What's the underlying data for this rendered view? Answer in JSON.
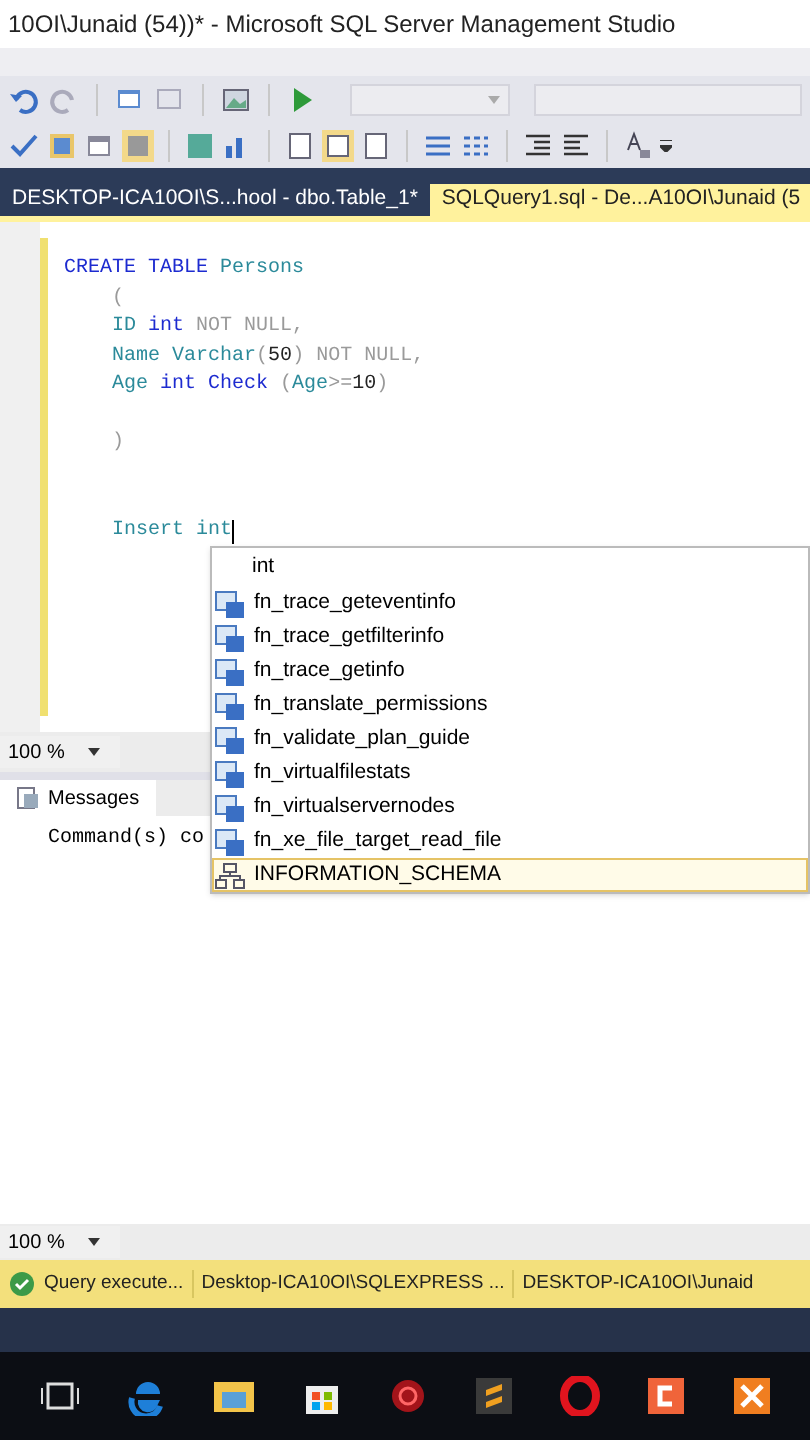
{
  "window": {
    "title": "10OI\\Junaid (54))* - Microsoft SQL Server Management Studio"
  },
  "tabs": [
    {
      "label": "DESKTOP-ICA10OI\\S...hool - dbo.Table_1*",
      "selected": false
    },
    {
      "label": "SQLQuery1.sql - De...A10OI\\Junaid (5",
      "selected": true
    }
  ],
  "editor": {
    "lines": [
      [
        {
          "text": "CREATE TABLE ",
          "kind": "keyword"
        },
        {
          "text": "Persons",
          "kind": "ident"
        }
      ],
      [
        {
          "text": "    (",
          "kind": "gray"
        }
      ],
      [
        {
          "text": "    ID ",
          "kind": "ident"
        },
        {
          "text": "int ",
          "kind": "keyword"
        },
        {
          "text": "NOT NULL,",
          "kind": "gray"
        }
      ],
      [
        {
          "text": "    Name ",
          "kind": "ident"
        },
        {
          "text": "Varchar",
          "kind": "ident"
        },
        {
          "text": "(",
          "kind": "gray"
        },
        {
          "text": "50",
          "kind": "plain"
        },
        {
          "text": ") NOT NULL,",
          "kind": "gray"
        }
      ],
      [
        {
          "text": "    Age ",
          "kind": "ident"
        },
        {
          "text": "int Check ",
          "kind": "keyword"
        },
        {
          "text": "(",
          "kind": "gray"
        },
        {
          "text": "Age",
          "kind": "ident"
        },
        {
          "text": ">=",
          "kind": "gray"
        },
        {
          "text": "10",
          "kind": "plain"
        },
        {
          "text": ")",
          "kind": "gray"
        }
      ],
      [
        {
          "kind": "blank"
        }
      ],
      [
        {
          "text": "    )",
          "kind": "gray"
        }
      ],
      [
        {
          "kind": "blank"
        }
      ],
      [
        {
          "kind": "blank"
        }
      ],
      [
        {
          "text": "    Insert int",
          "kind": "ident"
        }
      ]
    ]
  },
  "autocomplete": {
    "filter": "int",
    "items": [
      {
        "label": "fn_trace_geteventinfo",
        "kind": "function",
        "selected": false
      },
      {
        "label": "fn_trace_getfilterinfo",
        "kind": "function",
        "selected": false
      },
      {
        "label": "fn_trace_getinfo",
        "kind": "function",
        "selected": false
      },
      {
        "label": "fn_translate_permissions",
        "kind": "function",
        "selected": false
      },
      {
        "label": "fn_validate_plan_guide",
        "kind": "function",
        "selected": false
      },
      {
        "label": "fn_virtualfilestats",
        "kind": "function",
        "selected": false
      },
      {
        "label": "fn_virtualservernodes",
        "kind": "function",
        "selected": false
      },
      {
        "label": "fn_xe_file_target_read_file",
        "kind": "function",
        "selected": false
      },
      {
        "label": "INFORMATION_SCHEMA",
        "kind": "schema",
        "selected": true
      }
    ]
  },
  "editor_zoom": "100 %",
  "results": {
    "tab": "Messages",
    "message": "Command(s) co",
    "zoom": "100 %"
  },
  "status_bar": [
    "Query execute...",
    "Desktop-ICA10OI\\SQLEXPRESS ...",
    "DESKTOP-ICA10OI\\Junaid"
  ]
}
